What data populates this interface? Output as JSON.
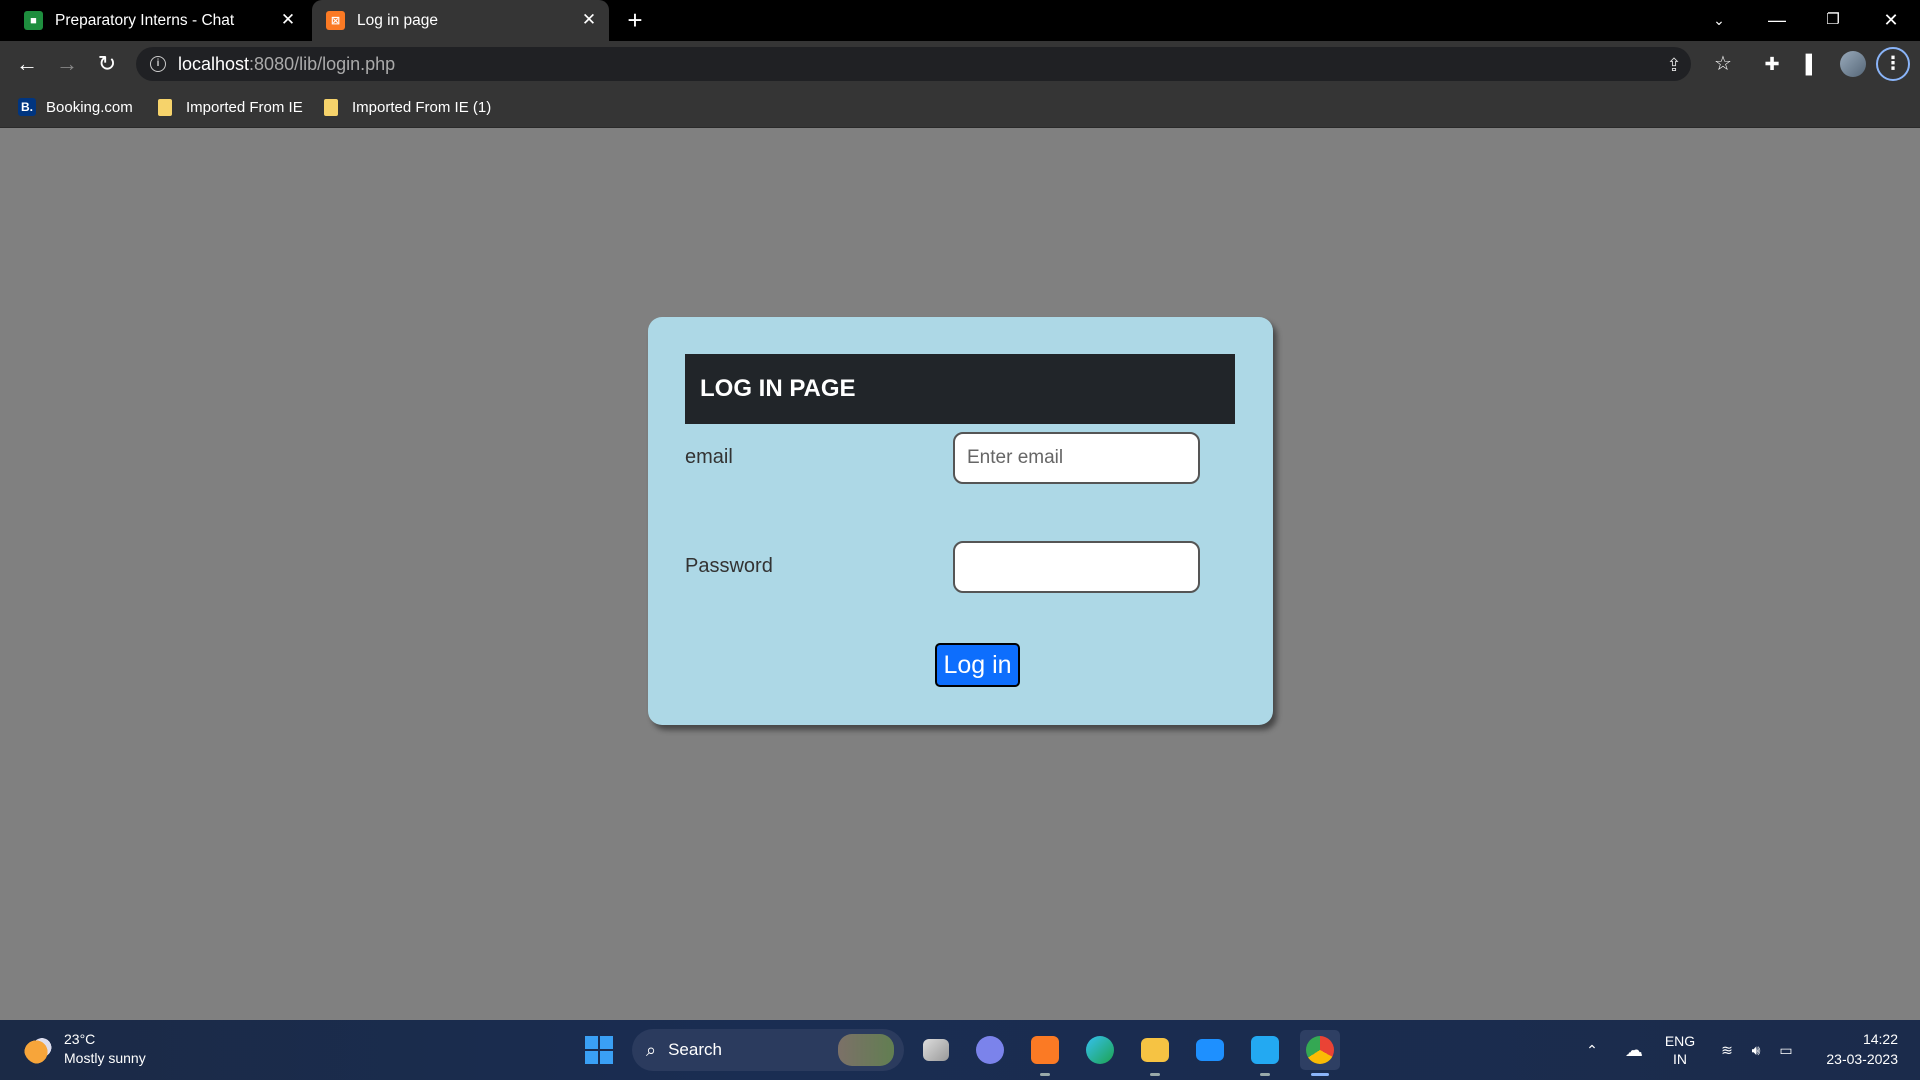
{
  "browser": {
    "tabs": [
      {
        "title": "Preparatory Interns - Chat",
        "icon": "google-chat-icon",
        "active": false
      },
      {
        "title": "Log in page",
        "icon": "xampp-icon",
        "active": true
      }
    ],
    "address": {
      "host": "localhost",
      "path": ":8080/lib/login.php"
    },
    "bookmarks": [
      {
        "label": "Booking.com",
        "icon": "booking-icon"
      },
      {
        "label": "Imported From IE",
        "icon": "folder-icon"
      },
      {
        "label": "Imported From IE (1)",
        "icon": "folder-icon"
      }
    ]
  },
  "page": {
    "header": "LOG IN PAGE",
    "email_label": "email",
    "email_placeholder": "Enter email",
    "email_value": "",
    "password_label": "Password",
    "password_value": "",
    "submit_label": "Log in"
  },
  "taskbar": {
    "weather": {
      "temp": "23°C",
      "condition": "Mostly sunny"
    },
    "search_label": "Search",
    "language": {
      "lang": "ENG",
      "region": "IN"
    },
    "time": "14:22",
    "date": "23-03-2023"
  },
  "colors": {
    "page_bg": "#808080",
    "card_bg": "#add8e6",
    "header_bg": "#212529",
    "button_bg": "#0d6efd"
  }
}
